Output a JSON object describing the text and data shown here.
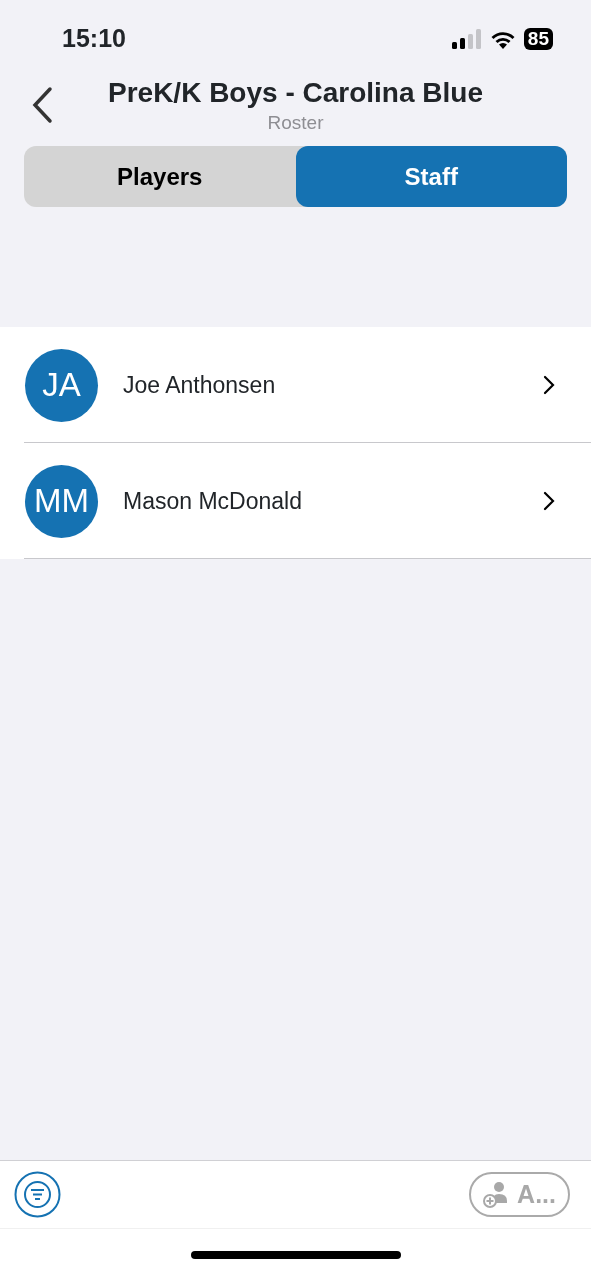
{
  "status_bar": {
    "time": "15:10",
    "battery": "85"
  },
  "header": {
    "title": "PreK/K Boys - Carolina Blue",
    "subtitle": "Roster"
  },
  "tabs": [
    {
      "label": "Players",
      "selected": false
    },
    {
      "label": "Staff",
      "selected": true
    }
  ],
  "staff": [
    {
      "initials": "JA",
      "name": "Joe Anthonsen"
    },
    {
      "initials": "MM",
      "name": "Mason McDonald"
    }
  ],
  "toolbar": {
    "add_button": {
      "label": "A...",
      "disabled": true
    }
  }
}
